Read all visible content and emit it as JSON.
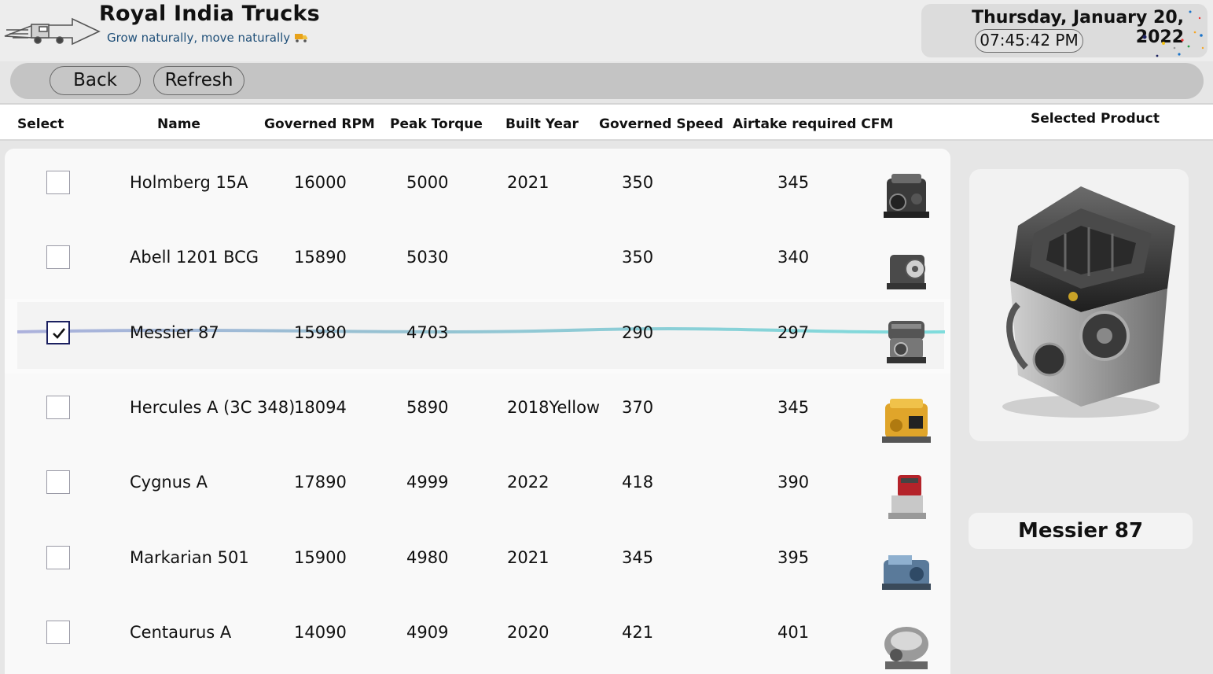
{
  "header": {
    "title": "Royal India Trucks",
    "tagline": "Grow naturally, move naturally",
    "date": "Thursday, January 20, 2022",
    "time": "07:45:42 PM"
  },
  "toolbar": {
    "back_label": "Back",
    "refresh_label": "Refresh"
  },
  "columns": {
    "select": "Select",
    "name": "Name",
    "governed_rpm": "Governed RPM",
    "peak_torque": "Peak Torque",
    "built_year": "Built Year",
    "governed_speed": "Governed Speed",
    "airtake": "Airtake required CFM"
  },
  "selected_product": {
    "heading": "Selected Product",
    "name": "Messier 87"
  },
  "rows": [
    {
      "name": "Holmberg 15A",
      "rpm": "16000",
      "torque": "5000",
      "year": "2021",
      "speed": "350",
      "cfm": "345",
      "checked": false,
      "image": "engine-dark-icon"
    },
    {
      "name": "Abell 1201 BCG",
      "rpm": "15890",
      "torque": "5030",
      "year": "",
      "speed": "350",
      "cfm": "340",
      "checked": false,
      "image": "engine-gray-icon"
    },
    {
      "name": "Messier 87",
      "rpm": "15980",
      "torque": "4703",
      "year": "",
      "speed": "290",
      "cfm": "297",
      "checked": true,
      "image": "engine-silver-icon"
    },
    {
      "name": "Hercules A (3C 348)",
      "rpm": "18094",
      "torque": "5890",
      "year": "2018Yellow",
      "speed": "370",
      "cfm": "345",
      "checked": false,
      "image": "engine-yellow-icon"
    },
    {
      "name": "Cygnus A",
      "rpm": "17890",
      "torque": "4999",
      "year": "2022",
      "speed": "418",
      "cfm": "390",
      "checked": false,
      "image": "engine-red-icon"
    },
    {
      "name": "Markarian 501",
      "rpm": "15900",
      "torque": "4980",
      "year": "2021",
      "speed": "345",
      "cfm": "395",
      "checked": false,
      "image": "engine-blue-icon"
    },
    {
      "name": "Centaurus A",
      "rpm": "14090",
      "torque": "4909",
      "year": "2020",
      "speed": "421",
      "cfm": "401",
      "checked": false,
      "image": "engine-chrome-icon"
    }
  ],
  "colors": {
    "accent_dark": "#1b2060",
    "tagline": "#1f4f78",
    "toolbar": "#c4c4c4"
  }
}
